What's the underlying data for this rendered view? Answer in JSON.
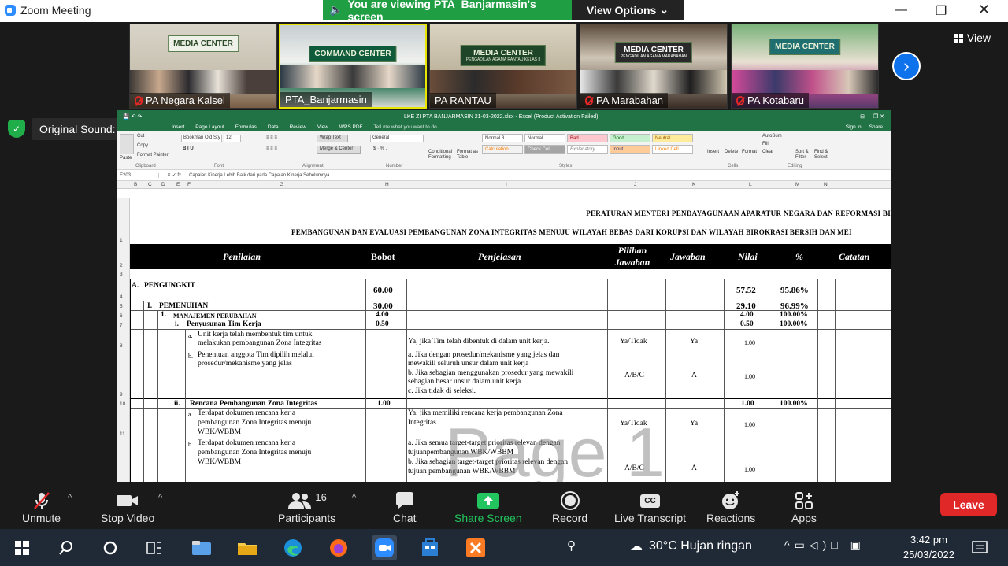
{
  "window": {
    "title": "Zoom Meeting"
  },
  "banner": {
    "viewing": "You are viewing PTA_Banjarmasin's screen",
    "view_options": "View Options"
  },
  "gallery": {
    "view_label": "View",
    "thumbs": [
      {
        "name": "PA Negara Kalsel",
        "banner": "MEDIA CENTER",
        "muted": true
      },
      {
        "name": "PTA_Banjarmasin",
        "banner": "COMMAND CENTER",
        "muted": false
      },
      {
        "name": "PA RANTAU",
        "banner": "MEDIA CENTER",
        "sub": "PENGADILAN AGAMA RANTAU KELAS II",
        "muted": false
      },
      {
        "name": "PA Marabahan",
        "banner": "MEDIA CENTER",
        "sub": "PENGADILAN AGAMA MARABAHAN",
        "muted": true
      },
      {
        "name": "PA Kotabaru",
        "banner": "MEDIA CENTER",
        "muted": true
      }
    ]
  },
  "sound": {
    "label": "Original Sound: On"
  },
  "excel": {
    "title": "LKE ZI PTA BANJARMASIN 21-03-2022.xlsx - Excel (Product Activation Failed)",
    "signin": "Sign in",
    "tabs": [
      "Insert",
      "Page Layout",
      "Formulas",
      "Data",
      "Review",
      "View",
      "WPS PDF",
      "Tell me what you want to do..."
    ],
    "share": "Share",
    "font": "Bookman Old Sty",
    "font_size": "12",
    "number_format": "General",
    "wrap_text": "Wrap Text",
    "merge": "Merge & Center",
    "styles": [
      "Normal 3",
      "Normal",
      "Bad",
      "Good",
      "Neutral",
      "Calculation",
      "Check Cell",
      "Explanatory ...",
      "Input",
      "Linked Cell"
    ],
    "clipboard_items": [
      "Cut",
      "Copy",
      "Format Painter",
      "Paste"
    ],
    "group_labels": [
      "Clipboard",
      "Font",
      "Alignment",
      "Number",
      "Styles",
      "Cells",
      "Editing"
    ],
    "cells_btns": [
      "Insert",
      "Delete",
      "Format"
    ],
    "editing_btns": [
      "AutoSum",
      "Fill",
      "Clear",
      "Sort & Filter",
      "Find & Select"
    ],
    "cond_fmt": "Conditional Formatting",
    "fmt_table": "Format as Table",
    "name_box": "E203",
    "formula": "Capaian Kinerja Lebih Baik dari pada Capaian Kinerja Sebelumnya",
    "columns": [
      "B",
      "C",
      "D",
      "E",
      "F",
      "G",
      "H",
      "I",
      "J",
      "K",
      "L",
      "M",
      "N"
    ],
    "rows": [
      "1",
      "2",
      "3",
      "4",
      "5",
      "6",
      "7",
      "8",
      "9",
      "10",
      "11"
    ]
  },
  "sheet": {
    "header1": "PERATURAN MENTERI PENDAYAGUNAAN APARATUR NEGARA DAN REFORMASI BI",
    "header2": "PEMBANGUNAN DAN EVALUASI PEMBANGUNAN ZONA INTEGRITAS MENUJU WILAYAH BEBAS DARI KORUPSI DAN WILAYAH BIROKRASI BERSIH DAN MEI",
    "columns": {
      "penilaian": "Penilaian",
      "bobot": "Bobot",
      "penjelasan": "Penjelasan",
      "pilihan": "Pilihan Jawaban",
      "jawaban": "Jawaban",
      "nilai": "Nilai",
      "persen": "%",
      "catatan": "Catatan"
    },
    "r4": {
      "code": "A.",
      "label": "PENGUNGKIT",
      "bobot": "60.00",
      "nilai": "57.52",
      "persen": "95.86%"
    },
    "r5": {
      "code": "I.",
      "label": "PEMENUHAN",
      "bobot": "30.00",
      "nilai": "29.10",
      "persen": "96.99%"
    },
    "r6": {
      "code": "1.",
      "label": "MANAJEMEN PERUBAHAN",
      "bobot": "4.00",
      "nilai": "4.00",
      "persen": "100.00%"
    },
    "r7": {
      "code": "i.",
      "label": "Penyusunan Tim Kerja",
      "bobot": "0.50",
      "nilai": "0.50",
      "persen": "100.00%"
    },
    "r8": {
      "code": "a.",
      "label1": "Unit kerja telah membentuk tim untuk",
      "label2": "melakukan pembangunan Zona Integritas",
      "penjelasan": "Ya, jika Tim telah dibentuk di dalam unit kerja.",
      "pilihan": "Ya/Tidak",
      "jawaban": "Ya",
      "nilai": "1.00"
    },
    "r9": {
      "code": "b.",
      "label1": "Penentuan anggota Tim dipilih melalui",
      "label2": "prosedur/mekanisme yang jelas",
      "p1": "a. Jika dengan prosedur/mekanisme yang jelas dan",
      "p2": "mewakili seluruh unsur dalam unit kerja",
      "p3": "b. Jika sebagian menggunakan prosedur yang mewakili",
      "p4": "sebagian besar unsur dalam unit kerja",
      "p5": "c. Jika tidak di seleksi.",
      "pilihan": "A/B/C",
      "jawaban": "A",
      "nilai": "1.00"
    },
    "r10": {
      "code": "ii.",
      "label": "Rencana Pembangunan Zona Integritas",
      "bobot": "1.00",
      "nilai": "1.00",
      "persen": "100.00%"
    },
    "r11": {
      "code": "a.",
      "label1": "Terdapat dokumen rencana kerja",
      "label2": "pembangunan Zona Integritas menuju",
      "label3": "WBK/WBBM",
      "p1": "Ya, jika memiliki  rencana kerja pembangunan Zona",
      "p2": "Integritas.",
      "pilihan": "Ya/Tidak",
      "jawaban": "Ya",
      "nilai": "1.00"
    },
    "r12": {
      "code": "b.",
      "label1": "Terdapat dokumen rencana kerja",
      "label2": "pembangunan Zona Integritas menuju",
      "label3": "WBK/WBBM",
      "p1": "a. Jika semua target-target prioritas relevan dengan",
      "p2": "tujuanpembangunan WBK/WBBM",
      "p3": "b. Jika sebagian target-target prioritas relevan dengan",
      "p4": "tujuan pembangunan WBK/WBBM",
      "pilihan": "A/B/C",
      "jawaban": "A",
      "nilai": "1.00"
    },
    "watermark": "Page 1"
  },
  "toolbar": {
    "unmute": "Unmute",
    "stop_video": "Stop Video",
    "participants": "Participants",
    "participants_count": "16",
    "chat": "Chat",
    "share": "Share Screen",
    "record": "Record",
    "transcript": "Live Transcript",
    "reactions": "Reactions",
    "apps": "Apps",
    "leave": "Leave",
    "cc": "CC"
  },
  "taskbar": {
    "weather": "30°C  Hujan ringan",
    "time": "3:42 pm",
    "date": "25/03/2022"
  }
}
